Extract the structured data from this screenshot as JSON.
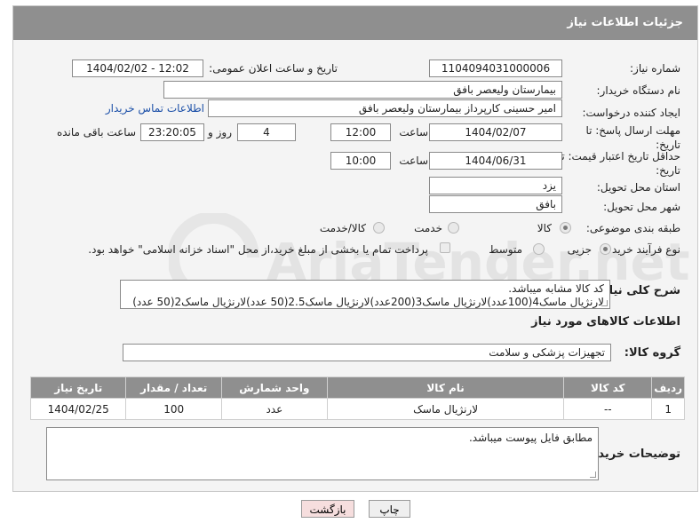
{
  "header": {
    "title": "جزئیات اطلاعات نیاز"
  },
  "form": {
    "need_number": {
      "label": "شماره نیاز:",
      "value": "1104094031000006"
    },
    "announce_datetime": {
      "label": "تاریخ و ساعت اعلان عمومی:",
      "value": "1404/02/02 - 12:02"
    },
    "buyer_org": {
      "label": "نام دستگاه خریدار:",
      "value": "بیمارستان ولیعصر بافق"
    },
    "requester": {
      "label": "ایجاد کننده درخواست:",
      "value": "امیر حسینی کارپرداز بیمارستان ولیعصر بافق",
      "contact_link": "اطلاعات تماس خریدار"
    },
    "reply_deadline": {
      "label": "مهلت ارسال پاسخ: تا تاریخ:",
      "date": "1404/02/07",
      "time_label": "ساعت",
      "time": "12:00",
      "days": "4",
      "days_label": "روز و",
      "remaining": "23:20:05",
      "remaining_label": "ساعت باقی مانده"
    },
    "price_validity": {
      "label": "حداقل تاریخ اعتبار قیمت: تا تاریخ:",
      "date": "1404/06/31",
      "time_label": "ساعت",
      "time": "10:00"
    },
    "province": {
      "label": "استان محل تحویل:",
      "value": "یزد"
    },
    "city": {
      "label": "شهر محل تحویل:",
      "value": "بافق"
    },
    "category": {
      "label": "طبقه بندی موضوعی:",
      "options": [
        "کالا",
        "خدمت",
        "کالا/خدمت"
      ],
      "selected": "کالا"
    },
    "purchase_type": {
      "label": "نوع فرآیند خرید :",
      "options": [
        "جزیی",
        "متوسط"
      ],
      "selected": "جزیی",
      "payment_note": "پرداخت تمام یا بخشی از مبلغ خرید،از محل \"اسناد خزانه اسلامی\" خواهد بود."
    }
  },
  "description": {
    "label": "شرح کلی نیاز:",
    "line1": "کد کالا مشابه میباشد.",
    "line2": "لارنژیال ماسک4(100عدد)لارنژیال ماسک3(200عدد)لارنژیال ماسک2.5(50 عدد)لارنژیال ماسک2(50 عدد)"
  },
  "goods_section": {
    "title": "اطلاعات کالاهای مورد نیاز",
    "group_label": "گروه کالا:",
    "group_value": "تجهیزات پزشکی و سلامت"
  },
  "table": {
    "headers": [
      "ردیف",
      "کد کالا",
      "نام کالا",
      "واحد شمارش",
      "تعداد / مقدار",
      "تاریخ نیاز"
    ],
    "rows": [
      [
        "1",
        "--",
        "لارنژیال ماسک",
        "عدد",
        "100",
        "1404/02/25"
      ]
    ]
  },
  "buyer_notes": {
    "label": "توضیحات خریدار:",
    "value": "مطابق فایل پیوست میباشد."
  },
  "buttons": {
    "print": "چاپ",
    "back": "بازگشت"
  },
  "watermark": {
    "text": "AriaTender.net"
  },
  "colors": {
    "header_bg": "#8f8f8f",
    "back_button_bg": "#f6dede",
    "link": "#1b4fa8"
  }
}
